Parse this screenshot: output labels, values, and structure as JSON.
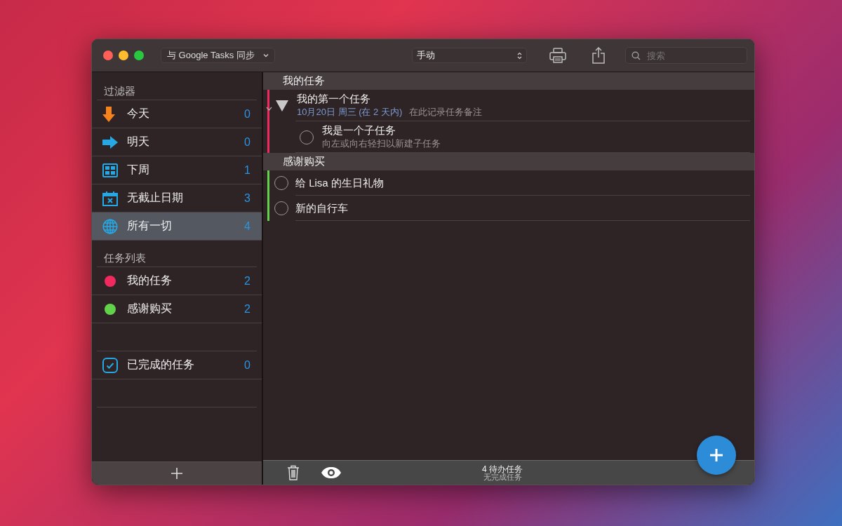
{
  "toolbar": {
    "sync_button": "与 Google Tasks 同步",
    "sort_select": "手动",
    "search": {
      "placeholder": "搜索"
    }
  },
  "sidebar": {
    "filters_header": "过滤器",
    "filters": [
      {
        "kind": "today",
        "label": "今天",
        "count": "0",
        "selected": false
      },
      {
        "kind": "tomorrow",
        "label": "明天",
        "count": "0",
        "selected": false
      },
      {
        "kind": "week",
        "label": "下周",
        "count": "1",
        "selected": false
      },
      {
        "kind": "nodate",
        "label": "无截止日期",
        "count": "3",
        "selected": false
      },
      {
        "kind": "all",
        "label": "所有一切",
        "count": "4",
        "selected": true
      }
    ],
    "lists_header": "任务列表",
    "lists": [
      {
        "label": "我的任务",
        "count": "2",
        "color": "#f0295f",
        "selected": false
      },
      {
        "label": "感谢购买",
        "count": "2",
        "color": "#62d24a",
        "selected": false
      }
    ],
    "completed": {
      "label": "已完成的任务",
      "count": "0",
      "selected": false
    }
  },
  "groups": [
    {
      "title": "我的任务",
      "color": "#f0295f",
      "tasks": [
        {
          "title": "我的第一个任务",
          "date": "10月20日 周三 (在 2 天内)",
          "note": "在此记录任务备注",
          "expanded": true,
          "children": [
            {
              "title": "我是一个子任务",
              "note": "向左或向右轻扫以新建子任务",
              "checked": false
            }
          ]
        }
      ]
    },
    {
      "title": "感谢购买",
      "color": "#62d24a",
      "tasks": [
        {
          "title": "给 Lisa 的生日礼物",
          "checked": false
        },
        {
          "title": "新的自行车",
          "checked": false
        }
      ]
    }
  ],
  "status": {
    "pending": "4 待办任务",
    "completed": "无完成任务"
  }
}
